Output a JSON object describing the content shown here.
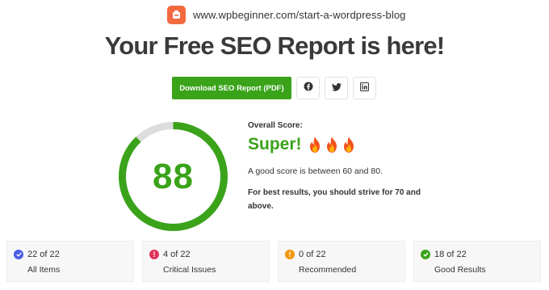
{
  "header": {
    "url": "www.wpbeginner.com/start-a-wordpress-blog",
    "logo_icon": "wpbeginner-logo-icon"
  },
  "title": "Your Free SEO Report is here!",
  "actions": {
    "download_label": "Download SEO Report (PDF)",
    "share": [
      {
        "icon": "facebook-icon"
      },
      {
        "icon": "twitter-icon"
      },
      {
        "icon": "linkedin-icon"
      }
    ]
  },
  "score": {
    "value": 88,
    "max": 100,
    "overall_label": "Overall Score:",
    "verdict": "Super!",
    "flame_icons": [
      "fire-emoji",
      "fire-emoji",
      "fire-emoji"
    ],
    "range_text": "A good score is between 60 and 80.",
    "advice_text": "For best results, you should strive for 70 and above."
  },
  "stats": [
    {
      "count": "22 of 22",
      "label": "All Items",
      "icon": "check-circle-icon",
      "color": "#4a5ee8"
    },
    {
      "count": "4 of 22",
      "label": "Critical Issues",
      "icon": "exclamation-circle-icon",
      "color": "#e0325a"
    },
    {
      "count": "0 of 22",
      "label": "Recommended",
      "icon": "exclamation-circle-icon",
      "color": "#f2960d"
    },
    {
      "count": "18 of 22",
      "label": "Good Results",
      "icon": "check-circle-icon",
      "color": "#3aa31a"
    }
  ],
  "colors": {
    "accent_green": "#3aa31a",
    "gauge_track": "#dddddd",
    "brand_orange": "#f26a3f"
  }
}
